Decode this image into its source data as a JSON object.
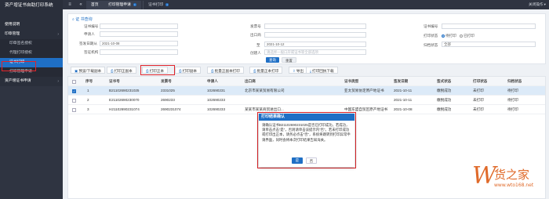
{
  "sidebar": {
    "title": "资产增证书自助打印系统",
    "items": [
      {
        "label": "使用说明",
        "type": "top",
        "chev": ""
      },
      {
        "label": "印章管理",
        "type": "top",
        "chev": "›"
      },
      {
        "label": "印章签名授权",
        "type": "sub",
        "chev": ""
      },
      {
        "label": "代理打印授权",
        "type": "sub",
        "chev": ""
      },
      {
        "label": "证书打印",
        "type": "sub",
        "chev": ""
      },
      {
        "label": "打印管理申请",
        "type": "sub",
        "chev": ""
      },
      {
        "label": "资产增证书申请",
        "type": "top",
        "chev": "›"
      }
    ]
  },
  "topbar": {
    "menu_icon": "≡",
    "back_icon": "«",
    "tabs": {
      "home": "首页",
      "one": "打印管理申请",
      "two": "证书打印"
    },
    "close_ops": "关闭操作 ▾"
  },
  "search": {
    "head": "证 书查询",
    "fields": {
      "cert_no": {
        "label": "证书编号",
        "value": ""
      },
      "apply_no": {
        "label": "申请人",
        "value": ""
      },
      "start_date": {
        "label": "签发日期从",
        "value": "2021-10-08"
      },
      "agent": {
        "label": "签证机构",
        "value": ""
      },
      "invoice": {
        "label": "发票号",
        "value": ""
      },
      "exit_port": {
        "label": "出口商",
        "value": ""
      },
      "end_date": {
        "label": "至",
        "value": "2021-10-12"
      },
      "creator": {
        "label": "创建人",
        "placeholder": "请选择一般口岸或证书等全部选项"
      },
      "cert_type": {
        "label": "证书编号",
        "value": ""
      },
      "print_status": {
        "label": "打印状态",
        "option1": "待打印",
        "option2": "已打印"
      },
      "print_range": {
        "label": "归档状态",
        "value": "全部"
      }
    },
    "search_btn": "查询",
    "reset_btn": "重置"
  },
  "toolbar": {
    "buttons": [
      "预览/下载副本",
      "打印正副本",
      "打印正本",
      "打印副本",
      "批量正副本打印",
      "批量正本打印",
      "导出",
      "打印回执下载"
    ]
  },
  "table": {
    "headers": [
      "序号",
      "证书号",
      "发票号",
      "申请人",
      "出口商",
      "证书类型",
      "签发日期",
      "签式状态",
      "打印状态",
      "归档状态"
    ],
    "rows": [
      {
        "no": "1",
        "cert": "B21102690231025",
        "invoice": "2331025",
        "applicant": "102690231",
        "exporter": "北京市某某贸易有限公司",
        "type": "亚太贸易协定原产地证书",
        "date": "2021-10-11",
        "sign": "缴税成功",
        "print": "未打印",
        "archive": "待打印",
        "checked": true
      },
      {
        "no": "2",
        "cert": "E21102690230070",
        "invoice": "2690233",
        "applicant": "102690233",
        "exporter": "",
        "type": "",
        "date": "2021-10-11",
        "sign": "缴税成功",
        "print": "未打印",
        "archive": "待打印",
        "checked": false
      },
      {
        "no": "3",
        "cert": "H21102690231074",
        "invoice": "2690231074",
        "applicant": "102690233",
        "exporter": "某某市某某商贸进出口...",
        "type": "中国东盟自贸区原产地证书",
        "date": "2021-10-08",
        "sign": "缴税成功",
        "print": "未打印",
        "archive": "待打印",
        "checked": false
      }
    ]
  },
  "modal": {
    "title": "打印结果确认",
    "body": "请确认证书B21102690231025是否已打印成功，若成功，请单击点击“是”，否则请单击该提示内“否”。若未打印成功或打印出正本，请务必点击“否”，系统将跳转到打印异常申请界面，同时会将本次打印结果告知海关。",
    "ok": "是",
    "no": "否"
  },
  "watermark": {
    "letter": "W",
    "name": "货之家",
    "url": "www.wto168.net"
  },
  "colors": {
    "accent": "#1f6fc5",
    "sidebar": "#2f3441",
    "highlight": "#e0242a",
    "watermark": "#e06a2a"
  }
}
